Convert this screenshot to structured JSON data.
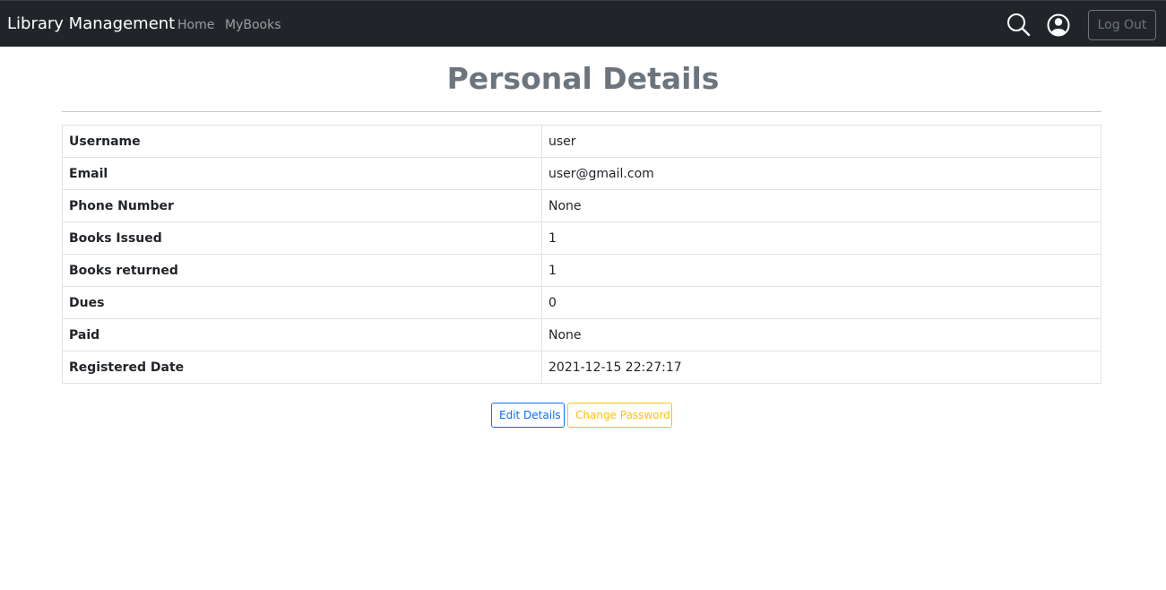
{
  "navbar": {
    "brand": "Library Management",
    "links": [
      {
        "label": "Home"
      },
      {
        "label": "MyBooks"
      }
    ],
    "icons": {
      "search": "search-icon",
      "user": "user-circle-icon"
    },
    "logout_label": "Log Out"
  },
  "page": {
    "title": "Personal Details"
  },
  "details": [
    {
      "label": "Username",
      "value": "user"
    },
    {
      "label": "Email",
      "value": "user@gmail.com"
    },
    {
      "label": "Phone Number",
      "value": "None"
    },
    {
      "label": "Books Issued",
      "value": "1"
    },
    {
      "label": "Books returned",
      "value": "1"
    },
    {
      "label": "Dues",
      "value": "0"
    },
    {
      "label": "Paid",
      "value": "None"
    },
    {
      "label": "Registered Date",
      "value": "2021-12-15 22:27:17"
    }
  ],
  "actions": {
    "edit_label": "Edit Details",
    "password_label": "Change Password"
  },
  "colors": {
    "navbar_bg": "#212529",
    "title": "#6c757d",
    "primary": "#0d6efd",
    "warning": "#ffc107"
  }
}
